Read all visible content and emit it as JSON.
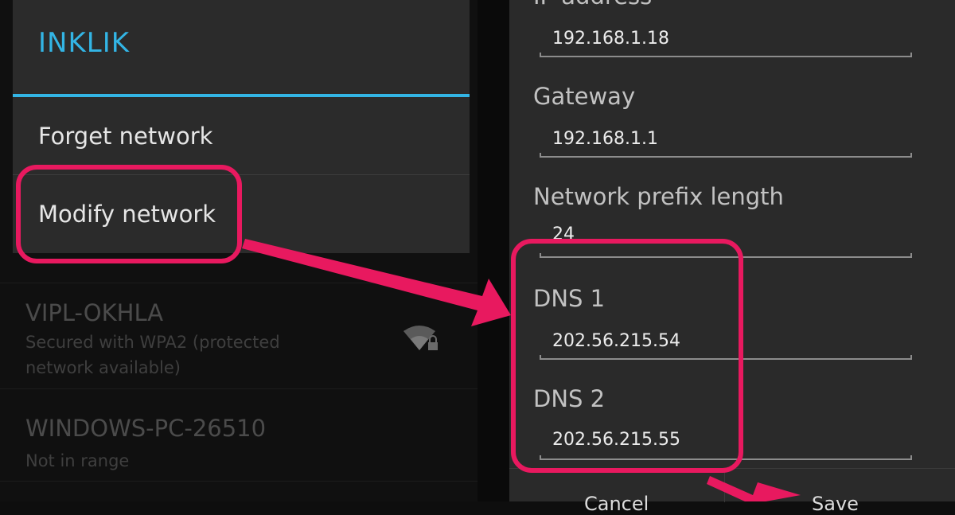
{
  "wifi_list": {
    "networks": [
      {
        "name": "VIPL-OKHLA",
        "subtitle": "Secured with WPA2 (protected network available)"
      },
      {
        "name": "WINDOWS-PC-26510",
        "subtitle": "Not in range"
      }
    ]
  },
  "context_menu": {
    "title": "INKLIK",
    "items": [
      "Forget network",
      "Modify network"
    ]
  },
  "dialog": {
    "ip_address": {
      "label": "IP address",
      "value": "192.168.1.18"
    },
    "gateway": {
      "label": "Gateway",
      "value": "192.168.1.1"
    },
    "prefix": {
      "label": "Network prefix length",
      "value": "24"
    },
    "dns1": {
      "label": "DNS 1",
      "value": "202.56.215.54"
    },
    "dns2": {
      "label": "DNS 2",
      "value": "202.56.215.55"
    },
    "buttons": {
      "cancel": "Cancel",
      "save": "Save"
    }
  },
  "colors": {
    "accent": "#33b5e5",
    "highlight": "#e8195f"
  },
  "icons": {
    "network_signal": "wifi-secured-icon"
  }
}
